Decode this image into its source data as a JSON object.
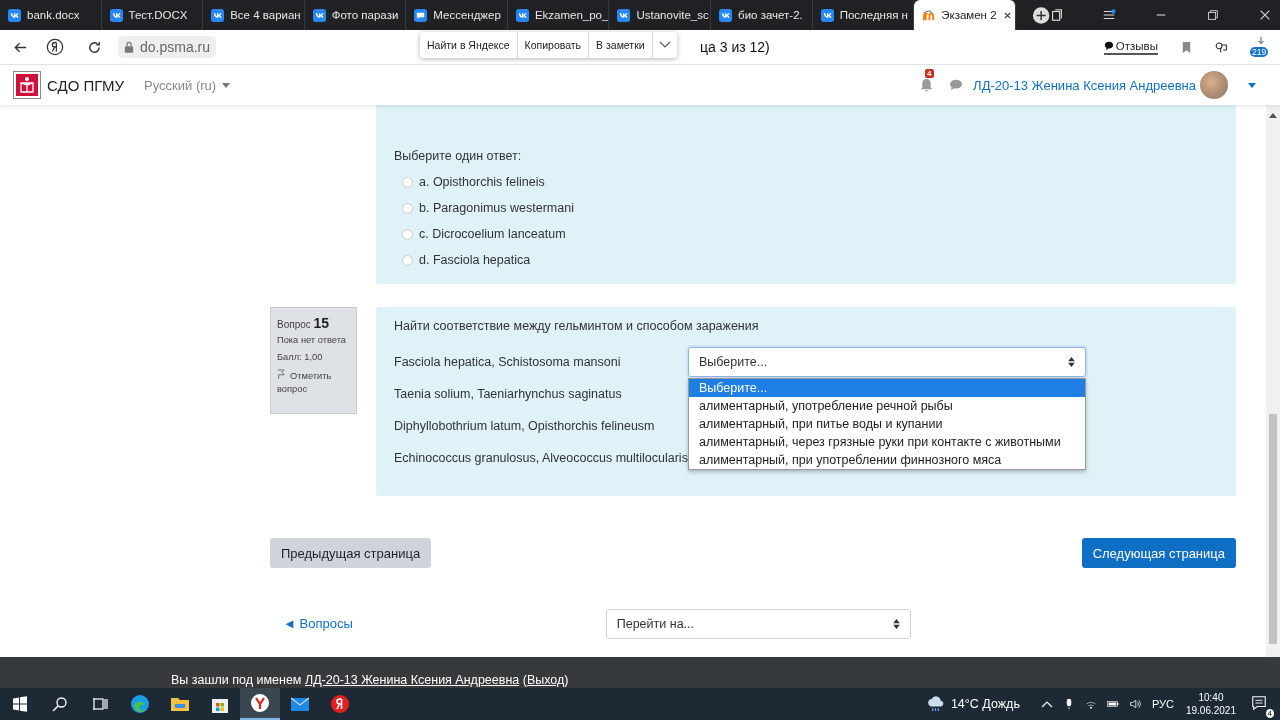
{
  "browser": {
    "tabs": [
      {
        "title": "bank.docx",
        "kind": "vk",
        "selected": false
      },
      {
        "title": "Тест.DOCX",
        "kind": "vk",
        "selected": false
      },
      {
        "title": "Все 4 вариан",
        "kind": "vk",
        "selected": false
      },
      {
        "title": "Фото парази",
        "kind": "vk",
        "selected": false
      },
      {
        "title": "Мессенджер",
        "kind": "chat",
        "selected": false
      },
      {
        "title": "Ekzamen_po_",
        "kind": "vk",
        "selected": false
      },
      {
        "title": "Ustanovite_sc",
        "kind": "vk",
        "selected": false
      },
      {
        "title": "био зачет-2.",
        "kind": "vk",
        "selected": false
      },
      {
        "title": "Последняя н",
        "kind": "vk",
        "selected": false
      },
      {
        "title": "Экзамен 2",
        "kind": "moodle",
        "selected": true
      }
    ],
    "url": "do.psma.ru",
    "title_fragment": "ца 3 из 12)",
    "selection_menu": [
      "Найти в Яндексе",
      "Копировать",
      "В заметки"
    ],
    "feedback": "Отзывы",
    "downloads_badge": "219"
  },
  "site": {
    "logo": "СДО ПГМУ",
    "language": "Русский (ru)",
    "notifications": "4",
    "user": "ЛД-20-13 Женина Ксения Андреевна"
  },
  "question14": {
    "prompt": "Выберите один ответ:",
    "options": [
      {
        "label": "a. Opisthorchis felineis",
        "selected": false
      },
      {
        "label": "b. Paragonimus westermani",
        "selected": false
      },
      {
        "label": "c. Dicrocoelium lanceatum",
        "selected": false
      },
      {
        "label": "d. Fasciola hepatica",
        "selected": false
      }
    ]
  },
  "question15": {
    "label": "Вопрос",
    "number": "15",
    "status": "Пока нет ответа",
    "mark": "Балл: 1,00",
    "flag": "Отметить вопрос",
    "text": "Найти соответствие между гельминтом и способом заражения",
    "stems": [
      "Fasciola hepatica, Schistosoma mansoni",
      "Taenia solium, Taeniarhynchus saginatus",
      "Diphyllobothrium latum, Opisthorchis felineusm",
      "Echinococcus granulosus, Alveococcus multilocularis"
    ],
    "select_value": "Выберите...",
    "dropdown": [
      {
        "label": "Выберите...",
        "selected": true
      },
      {
        "label": "алиментарный, употребление речной рыбы",
        "selected": false
      },
      {
        "label": "алиментарный, при питье воды и купании",
        "selected": false
      },
      {
        "label": "алиментарный, через грязные руки при контакте с животными",
        "selected": false
      },
      {
        "label": "алиментарный, при употреблении финнозного мяса",
        "selected": false
      }
    ]
  },
  "navigation": {
    "previous": "Предыдущая страница",
    "next": "Следующая страница",
    "questions_link": "◄ Вопросы",
    "jump": "Перейти на..."
  },
  "footer": {
    "prefix": "Вы зашли под именем",
    "user": "ЛД-20-13 Женина Ксения Андреевна",
    "open": "(",
    "logout": "Выход",
    "close": ")"
  },
  "taskbar": {
    "apps": [
      {
        "kind": "edge",
        "selected": false
      },
      {
        "kind": "explorer",
        "selected": false
      },
      {
        "kind": "store",
        "selected": false
      },
      {
        "kind": "ybrowser",
        "selected": true
      },
      {
        "kind": "mail",
        "selected": false
      },
      {
        "kind": "yandex",
        "selected": false
      }
    ],
    "weather": "14°C Дождь",
    "language": "РУС",
    "time": "10:40",
    "date": "19.06.2021",
    "notifications": "4"
  }
}
